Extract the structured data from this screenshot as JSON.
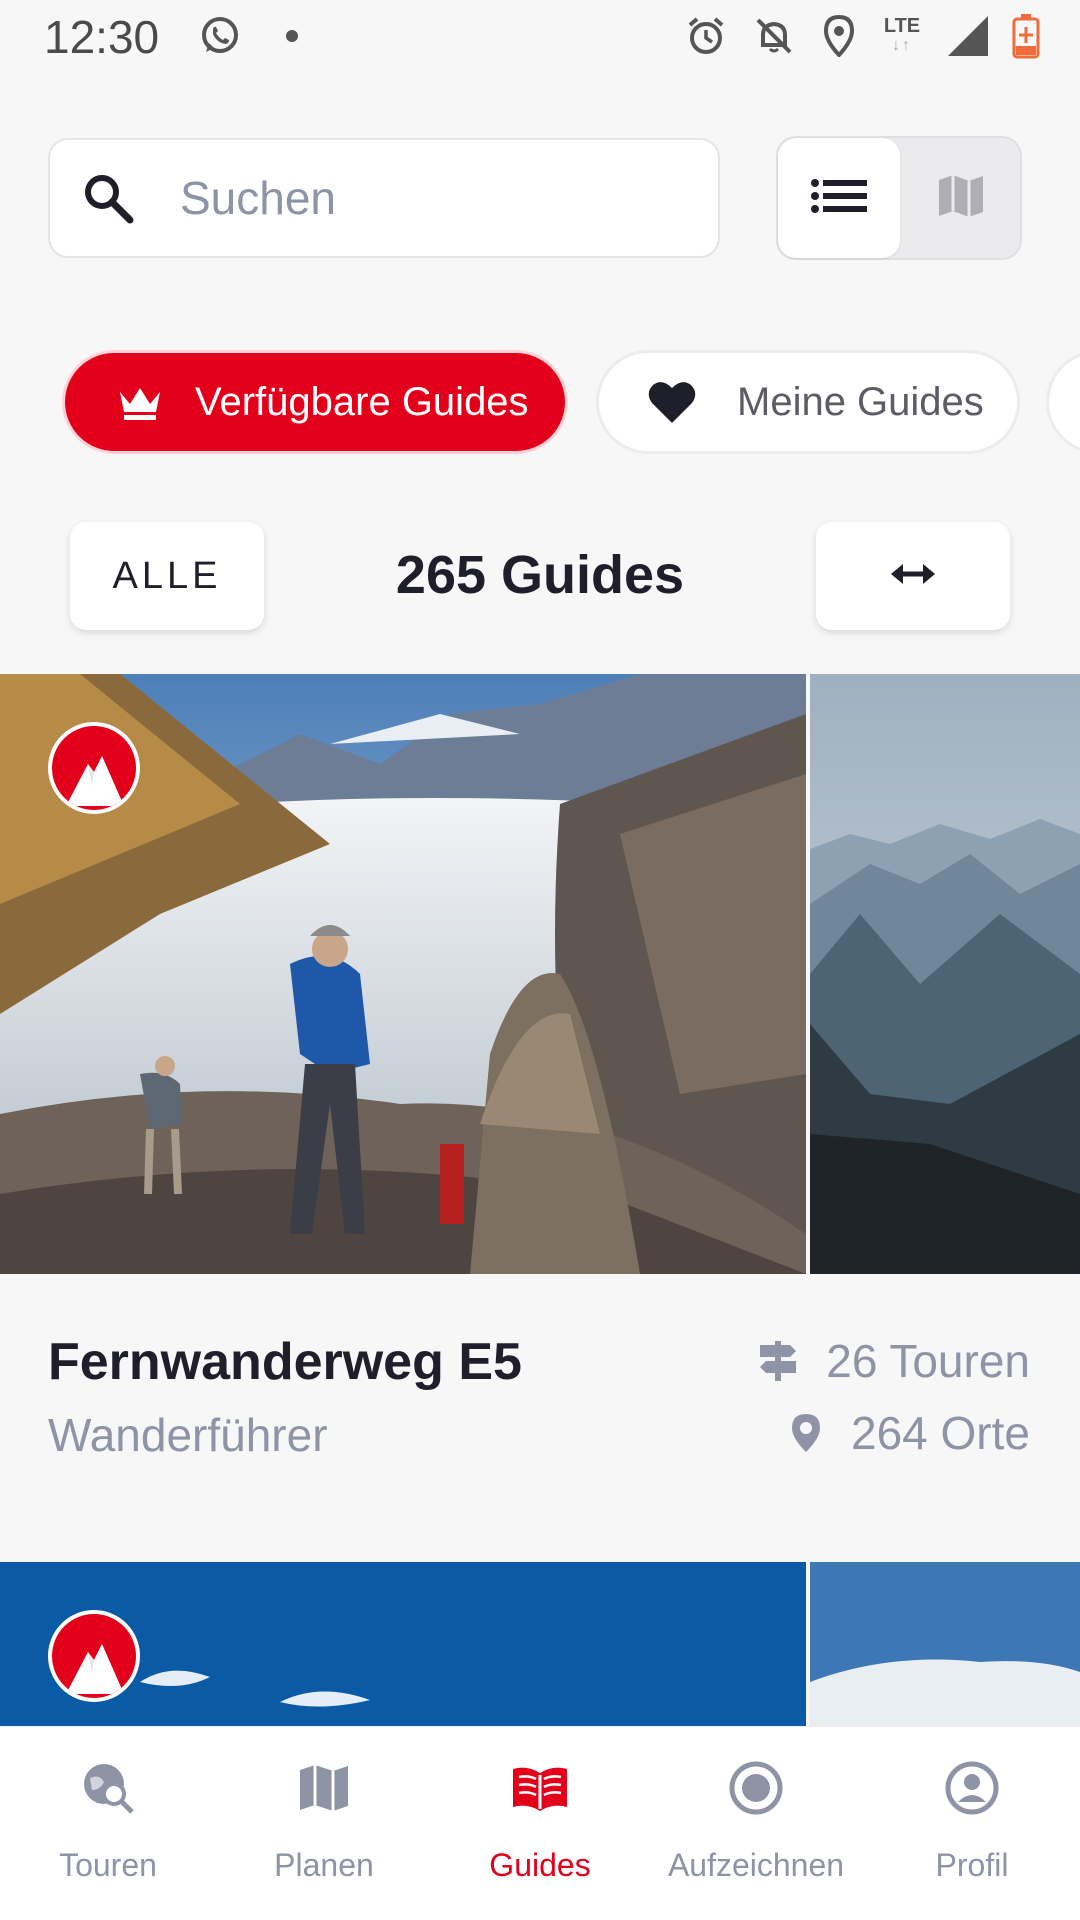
{
  "status_bar": {
    "time": "12:30",
    "network": "LTE",
    "icons": [
      "whatsapp-icon",
      "notification-dot-icon",
      "alarm-icon",
      "notifications-off-icon",
      "location-icon",
      "lte-icon",
      "signal-icon",
      "battery-charging-icon"
    ]
  },
  "search": {
    "placeholder": "Suchen",
    "value": ""
  },
  "view_toggle": {
    "options": [
      "list-view",
      "map-view"
    ],
    "selected": "list-view"
  },
  "chips": {
    "available": "Verfügbare Guides",
    "mine": "Meine Guides"
  },
  "filter": {
    "all_label": "ALLE",
    "count_label": "265 Guides"
  },
  "guides": [
    {
      "title": "Fernwanderweg E5",
      "subtitle": "Wanderführer",
      "tours": "26 Touren",
      "places": "264 Orte"
    }
  ],
  "bottom_nav": {
    "items": [
      {
        "label": "Touren",
        "icon": "tour-search-icon"
      },
      {
        "label": "Planen",
        "icon": "map-icon"
      },
      {
        "label": "Guides",
        "icon": "book-icon"
      },
      {
        "label": "Aufzeichnen",
        "icon": "record-icon"
      },
      {
        "label": "Profil",
        "icon": "profile-icon"
      }
    ],
    "active": "Guides"
  },
  "colors": {
    "accent": "#e3001b",
    "text": "#1f1f2b",
    "muted": "#8e93a6",
    "background": "#f7f7f8"
  }
}
